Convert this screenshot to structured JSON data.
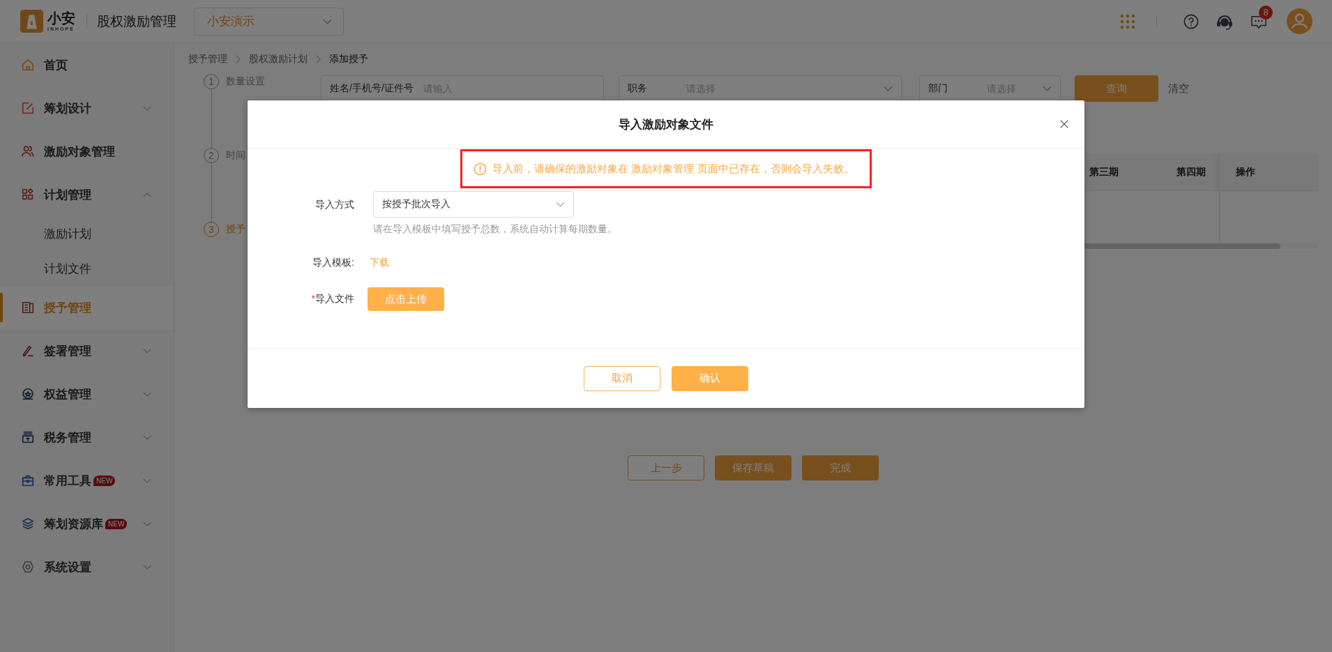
{
  "header": {
    "logo_text": "小安",
    "logo_subtext": "INHOPE",
    "app_title": "股权激励管理",
    "company_select": {
      "value": "小安演示"
    },
    "notification_count": "8"
  },
  "sidebar": {
    "items": [
      {
        "label": "首页",
        "selected": false
      },
      {
        "label": "筹划设计",
        "selected": false,
        "expanded": false
      },
      {
        "label": "激励对象管理",
        "selected": false
      },
      {
        "label": "计划管理",
        "selected": false,
        "expanded": true,
        "children": [
          {
            "label": "激励计划",
            "selected": false
          },
          {
            "label": "计划文件",
            "selected": false
          }
        ]
      },
      {
        "label": "授予管理",
        "selected": true
      },
      {
        "label": "签署管理",
        "selected": false,
        "expanded": false
      },
      {
        "label": "权益管理",
        "selected": false,
        "expanded": false
      },
      {
        "label": "税务管理",
        "selected": false,
        "expanded": false
      },
      {
        "label": "常用工具",
        "selected": false,
        "expanded": false,
        "badge": "NEW"
      },
      {
        "label": "筹划资源库",
        "selected": false,
        "expanded": false,
        "badge": "NEW"
      },
      {
        "label": "系统设置",
        "selected": false,
        "expanded": false
      }
    ]
  },
  "breadcrumb": [
    {
      "label": "授予管理",
      "current": false
    },
    {
      "label": "股权激励计划",
      "current": false
    },
    {
      "label": "添加授予",
      "current": true
    }
  ],
  "steps": [
    {
      "number": "1",
      "label": "数量设置",
      "selected": false
    },
    {
      "number": "2",
      "label": "时间",
      "selected": false
    },
    {
      "number": "3",
      "label": "授予",
      "selected": true
    }
  ],
  "filters": [
    {
      "kind": "input",
      "label": "姓名/手机号/证件号",
      "placeholder": "请输入"
    },
    {
      "kind": "select",
      "label": "职务",
      "placeholder": "请选择"
    },
    {
      "kind": "select",
      "label": "部门",
      "placeholder": "请选择"
    }
  ],
  "filter_buttons": [
    {
      "label": "查询",
      "kind": "primary"
    },
    {
      "label": "清空",
      "kind": "text"
    }
  ],
  "table": {
    "columns": [
      "第三期",
      "第四期",
      "操作"
    ]
  },
  "footer_buttons": [
    {
      "label": "上一步",
      "kind": "outline"
    },
    {
      "label": "保存草稿",
      "kind": "primary"
    },
    {
      "label": "完成",
      "kind": "primary"
    }
  ],
  "modal": {
    "title": "导入激励对象文件",
    "warning": {
      "text": "导入前，请确保的激励对象在 激励对象管理 页面中已存在，否则会导入失败。",
      "highlighted": true
    },
    "fields": [
      {
        "kind": "select",
        "label": "导入方式",
        "value": "按授予批次导入",
        "hint": "请在导入模板中填写授予总数，系统自动计算每期数量。"
      },
      {
        "kind": "link",
        "label": "导入模板:",
        "link": "下载"
      },
      {
        "kind": "upload",
        "label": "导入文件",
        "button": "点击上传",
        "required_marker": "*"
      }
    ],
    "buttons": [
      {
        "label": "取消",
        "kind": "outline"
      },
      {
        "label": "确认",
        "kind": "primary"
      }
    ]
  }
}
